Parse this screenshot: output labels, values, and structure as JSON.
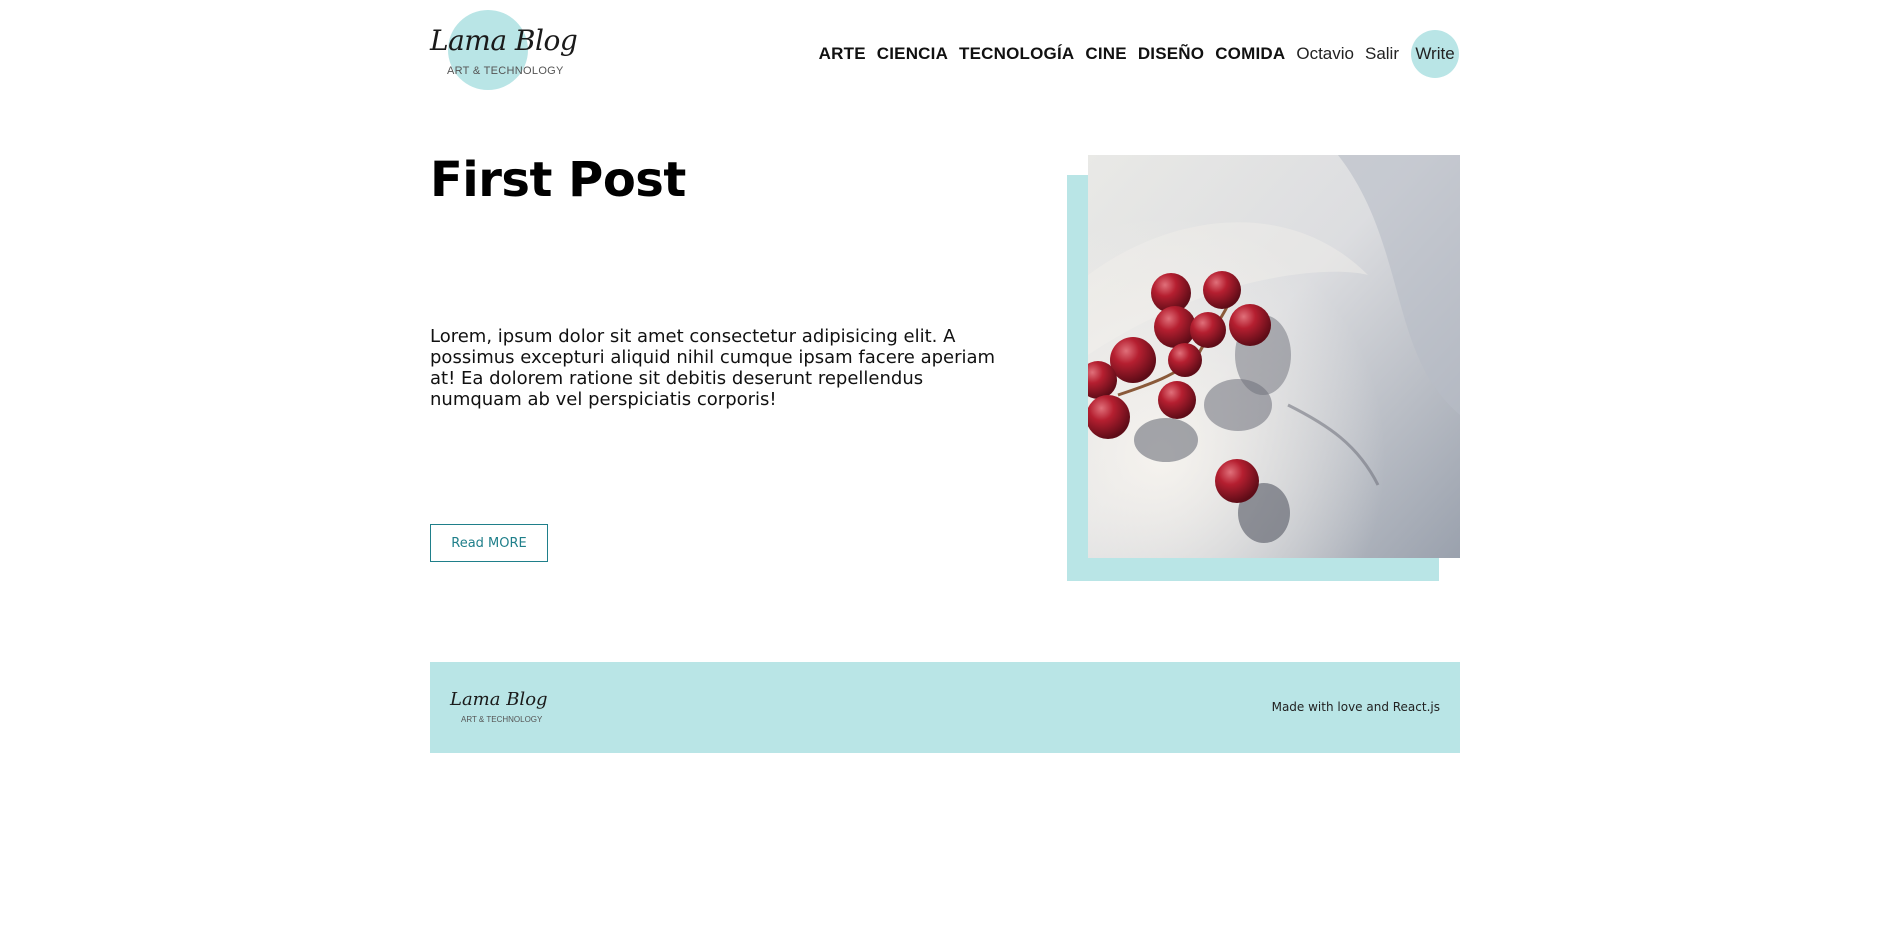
{
  "header": {
    "logo_title": "Lama Blog",
    "logo_subtitle": "ART & TECHNOLOGY",
    "nav_categories": [
      {
        "label": "ARTE"
      },
      {
        "label": "CIENCIA"
      },
      {
        "label": "TECNOLOGÍA"
      },
      {
        "label": "CINE"
      },
      {
        "label": "DISEÑO"
      },
      {
        "label": "COMIDA"
      }
    ],
    "user_name": "Octavio",
    "logout_label": "Salir",
    "write_label": "Write"
  },
  "post": {
    "title": "First Post",
    "description": "Lorem, ipsum dolor sit amet consectetur adipisicing elit. A possimus excepturi aliquid nihil cumque ipsam facere aperiam at! Ea dolorem ratione sit debitis deserunt repellendus numquam ab vel perspiciatis corporis!",
    "read_more_label": "Read MORE",
    "image_subject": "red-grapes-photo"
  },
  "footer": {
    "logo_title": "Lama Blog",
    "logo_subtitle": "ART & TECHNOLOGY",
    "credit": "Made with love and React.js"
  },
  "colors": {
    "accent": "#b9e5e6",
    "button_teal": "#1f7f8a",
    "text": "#111111"
  }
}
